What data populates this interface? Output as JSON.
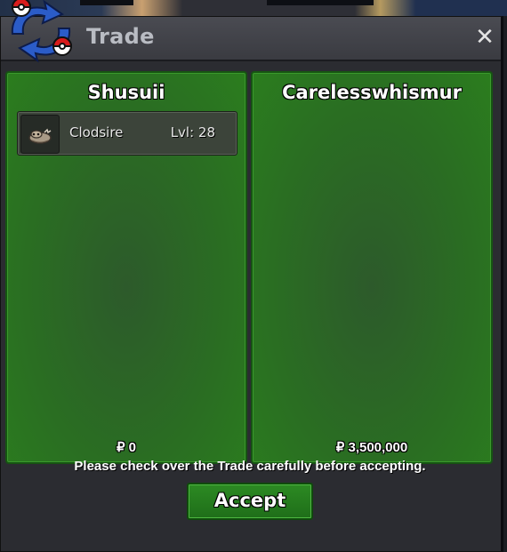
{
  "window": {
    "title": "Trade"
  },
  "left_panel": {
    "player_name": "Shusuii",
    "items": [
      {
        "name": "Clodsire",
        "level": "Lvl: 28"
      }
    ],
    "money": "₽ 0"
  },
  "right_panel": {
    "player_name": "Carelesswhismur",
    "items": [],
    "money": "₽ 3,500,000"
  },
  "footer": {
    "notice": "Please check over the Trade carefully before accepting.",
    "accept_label": "Accept"
  },
  "colors": {
    "panel_green": "#2a6e22",
    "button_green": "#2c8a23",
    "titlebar": "#3f4046",
    "title_text": "#b9bcc3"
  },
  "icons": {
    "window_logo": "trade-arrows-pokeballs-icon",
    "close": "close-icon",
    "item": "clodsire-sprite-icon"
  }
}
